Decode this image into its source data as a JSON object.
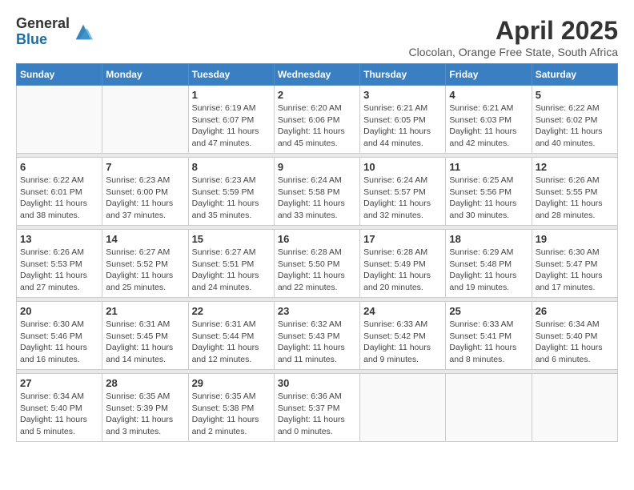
{
  "logo": {
    "general": "General",
    "blue": "Blue"
  },
  "title": "April 2025",
  "location": "Clocolan, Orange Free State, South Africa",
  "days_of_week": [
    "Sunday",
    "Monday",
    "Tuesday",
    "Wednesday",
    "Thursday",
    "Friday",
    "Saturday"
  ],
  "weeks": [
    [
      {
        "day": "",
        "info": ""
      },
      {
        "day": "",
        "info": ""
      },
      {
        "day": "1",
        "info": "Sunrise: 6:19 AM\nSunset: 6:07 PM\nDaylight: 11 hours and 47 minutes."
      },
      {
        "day": "2",
        "info": "Sunrise: 6:20 AM\nSunset: 6:06 PM\nDaylight: 11 hours and 45 minutes."
      },
      {
        "day": "3",
        "info": "Sunrise: 6:21 AM\nSunset: 6:05 PM\nDaylight: 11 hours and 44 minutes."
      },
      {
        "day": "4",
        "info": "Sunrise: 6:21 AM\nSunset: 6:03 PM\nDaylight: 11 hours and 42 minutes."
      },
      {
        "day": "5",
        "info": "Sunrise: 6:22 AM\nSunset: 6:02 PM\nDaylight: 11 hours and 40 minutes."
      }
    ],
    [
      {
        "day": "6",
        "info": "Sunrise: 6:22 AM\nSunset: 6:01 PM\nDaylight: 11 hours and 38 minutes."
      },
      {
        "day": "7",
        "info": "Sunrise: 6:23 AM\nSunset: 6:00 PM\nDaylight: 11 hours and 37 minutes."
      },
      {
        "day": "8",
        "info": "Sunrise: 6:23 AM\nSunset: 5:59 PM\nDaylight: 11 hours and 35 minutes."
      },
      {
        "day": "9",
        "info": "Sunrise: 6:24 AM\nSunset: 5:58 PM\nDaylight: 11 hours and 33 minutes."
      },
      {
        "day": "10",
        "info": "Sunrise: 6:24 AM\nSunset: 5:57 PM\nDaylight: 11 hours and 32 minutes."
      },
      {
        "day": "11",
        "info": "Sunrise: 6:25 AM\nSunset: 5:56 PM\nDaylight: 11 hours and 30 minutes."
      },
      {
        "day": "12",
        "info": "Sunrise: 6:26 AM\nSunset: 5:55 PM\nDaylight: 11 hours and 28 minutes."
      }
    ],
    [
      {
        "day": "13",
        "info": "Sunrise: 6:26 AM\nSunset: 5:53 PM\nDaylight: 11 hours and 27 minutes."
      },
      {
        "day": "14",
        "info": "Sunrise: 6:27 AM\nSunset: 5:52 PM\nDaylight: 11 hours and 25 minutes."
      },
      {
        "day": "15",
        "info": "Sunrise: 6:27 AM\nSunset: 5:51 PM\nDaylight: 11 hours and 24 minutes."
      },
      {
        "day": "16",
        "info": "Sunrise: 6:28 AM\nSunset: 5:50 PM\nDaylight: 11 hours and 22 minutes."
      },
      {
        "day": "17",
        "info": "Sunrise: 6:28 AM\nSunset: 5:49 PM\nDaylight: 11 hours and 20 minutes."
      },
      {
        "day": "18",
        "info": "Sunrise: 6:29 AM\nSunset: 5:48 PM\nDaylight: 11 hours and 19 minutes."
      },
      {
        "day": "19",
        "info": "Sunrise: 6:30 AM\nSunset: 5:47 PM\nDaylight: 11 hours and 17 minutes."
      }
    ],
    [
      {
        "day": "20",
        "info": "Sunrise: 6:30 AM\nSunset: 5:46 PM\nDaylight: 11 hours and 16 minutes."
      },
      {
        "day": "21",
        "info": "Sunrise: 6:31 AM\nSunset: 5:45 PM\nDaylight: 11 hours and 14 minutes."
      },
      {
        "day": "22",
        "info": "Sunrise: 6:31 AM\nSunset: 5:44 PM\nDaylight: 11 hours and 12 minutes."
      },
      {
        "day": "23",
        "info": "Sunrise: 6:32 AM\nSunset: 5:43 PM\nDaylight: 11 hours and 11 minutes."
      },
      {
        "day": "24",
        "info": "Sunrise: 6:33 AM\nSunset: 5:42 PM\nDaylight: 11 hours and 9 minutes."
      },
      {
        "day": "25",
        "info": "Sunrise: 6:33 AM\nSunset: 5:41 PM\nDaylight: 11 hours and 8 minutes."
      },
      {
        "day": "26",
        "info": "Sunrise: 6:34 AM\nSunset: 5:40 PM\nDaylight: 11 hours and 6 minutes."
      }
    ],
    [
      {
        "day": "27",
        "info": "Sunrise: 6:34 AM\nSunset: 5:40 PM\nDaylight: 11 hours and 5 minutes."
      },
      {
        "day": "28",
        "info": "Sunrise: 6:35 AM\nSunset: 5:39 PM\nDaylight: 11 hours and 3 minutes."
      },
      {
        "day": "29",
        "info": "Sunrise: 6:35 AM\nSunset: 5:38 PM\nDaylight: 11 hours and 2 minutes."
      },
      {
        "day": "30",
        "info": "Sunrise: 6:36 AM\nSunset: 5:37 PM\nDaylight: 11 hours and 0 minutes."
      },
      {
        "day": "",
        "info": ""
      },
      {
        "day": "",
        "info": ""
      },
      {
        "day": "",
        "info": ""
      }
    ]
  ]
}
